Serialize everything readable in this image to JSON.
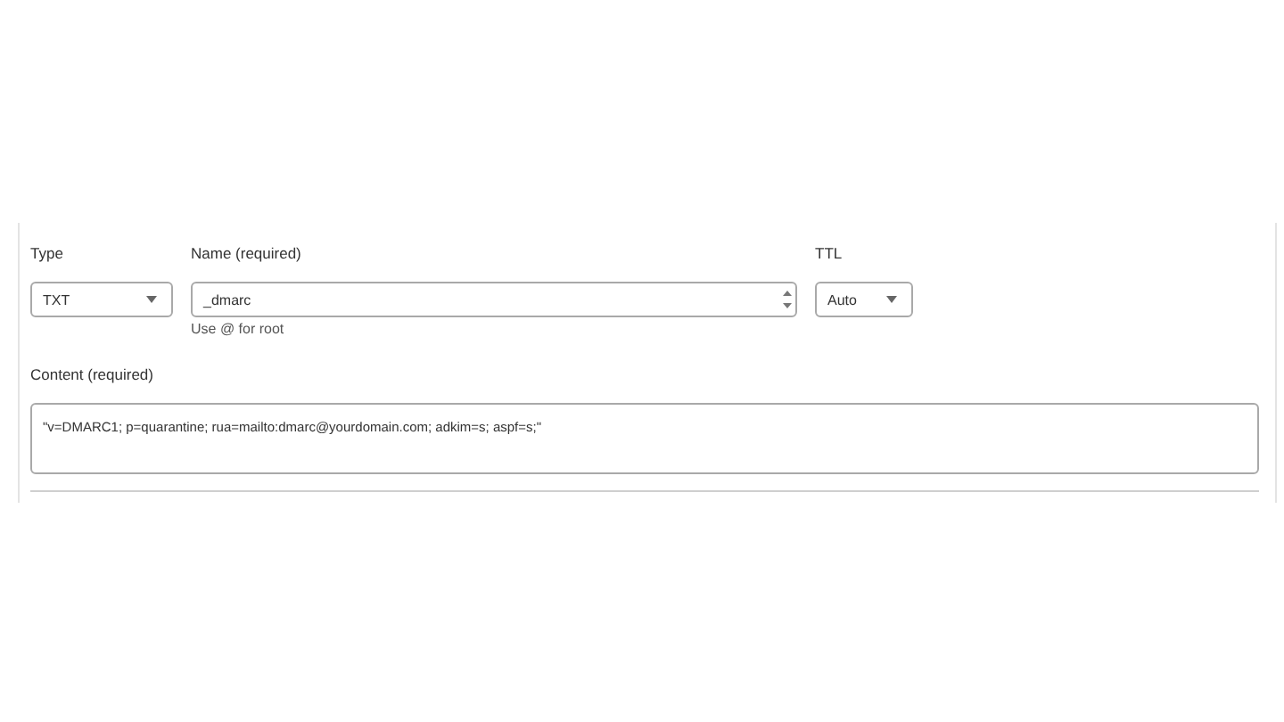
{
  "type_field": {
    "label": "Type",
    "value": "TXT"
  },
  "name_field": {
    "label": "Name (required)",
    "value": "_dmarc",
    "hint": "Use @ for root"
  },
  "ttl_field": {
    "label": "TTL",
    "value": "Auto"
  },
  "content_field": {
    "label": "Content (required)",
    "value": "\"v=DMARC1; p=quarantine; rua=mailto:dmarc@yourdomain.com; adkim=s; aspf=s;\""
  }
}
